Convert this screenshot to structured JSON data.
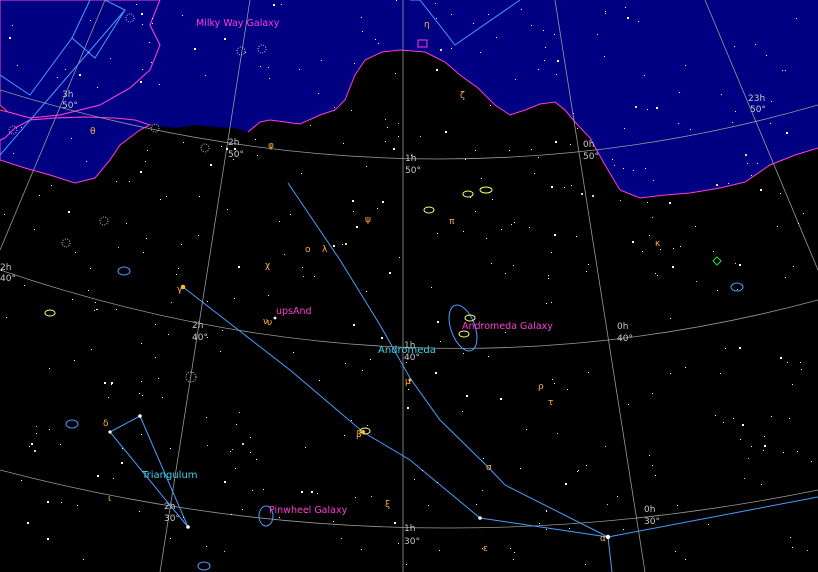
{
  "colors": {
    "sky": "#000000",
    "milky_way_fill": "#000082",
    "milky_way_edge": "#ff3dd4",
    "grid": "#9a9a9a",
    "constellation_lines": "#4a9cff",
    "constellation_labels": "#3fd2e8",
    "dso_labels": "#ff3dd4",
    "galaxy_outline": "#ffff66",
    "star_labels": "#ffb13b",
    "stars": "#ffffff"
  },
  "milky_way": {
    "label": "Milky Way Galaxy"
  },
  "constellations": [
    {
      "name": "Andromeda"
    },
    {
      "name": "Triangulum"
    }
  ],
  "deep_sky_objects": [
    {
      "name": "Andromeda Galaxy"
    },
    {
      "name": "Pinwheel Galaxy"
    },
    {
      "name": "upsAnd"
    }
  ],
  "grid_labels": {
    "ra": [
      "3h",
      "2h",
      "1h",
      "0h",
      "23h",
      "2h",
      "1h",
      "0h",
      "2h",
      "1h",
      "0h",
      "2h",
      "1h",
      "0h",
      "0h"
    ],
    "dec": [
      "50°",
      "50°",
      "50°",
      "50°",
      "50°",
      "40°",
      "40°",
      "40°",
      "40°",
      "30°",
      "30°",
      "30°"
    ]
  },
  "star_greek_labels": [
    "γ",
    "θ",
    "ψ",
    "ν",
    "μ",
    "λ",
    "ζ",
    "η",
    "ο",
    "φ",
    "ε",
    "δ",
    "ι",
    "κ",
    "π",
    "υ",
    "χ",
    "σ",
    "ρ",
    "β",
    "ξ",
    "α",
    "τ"
  ]
}
